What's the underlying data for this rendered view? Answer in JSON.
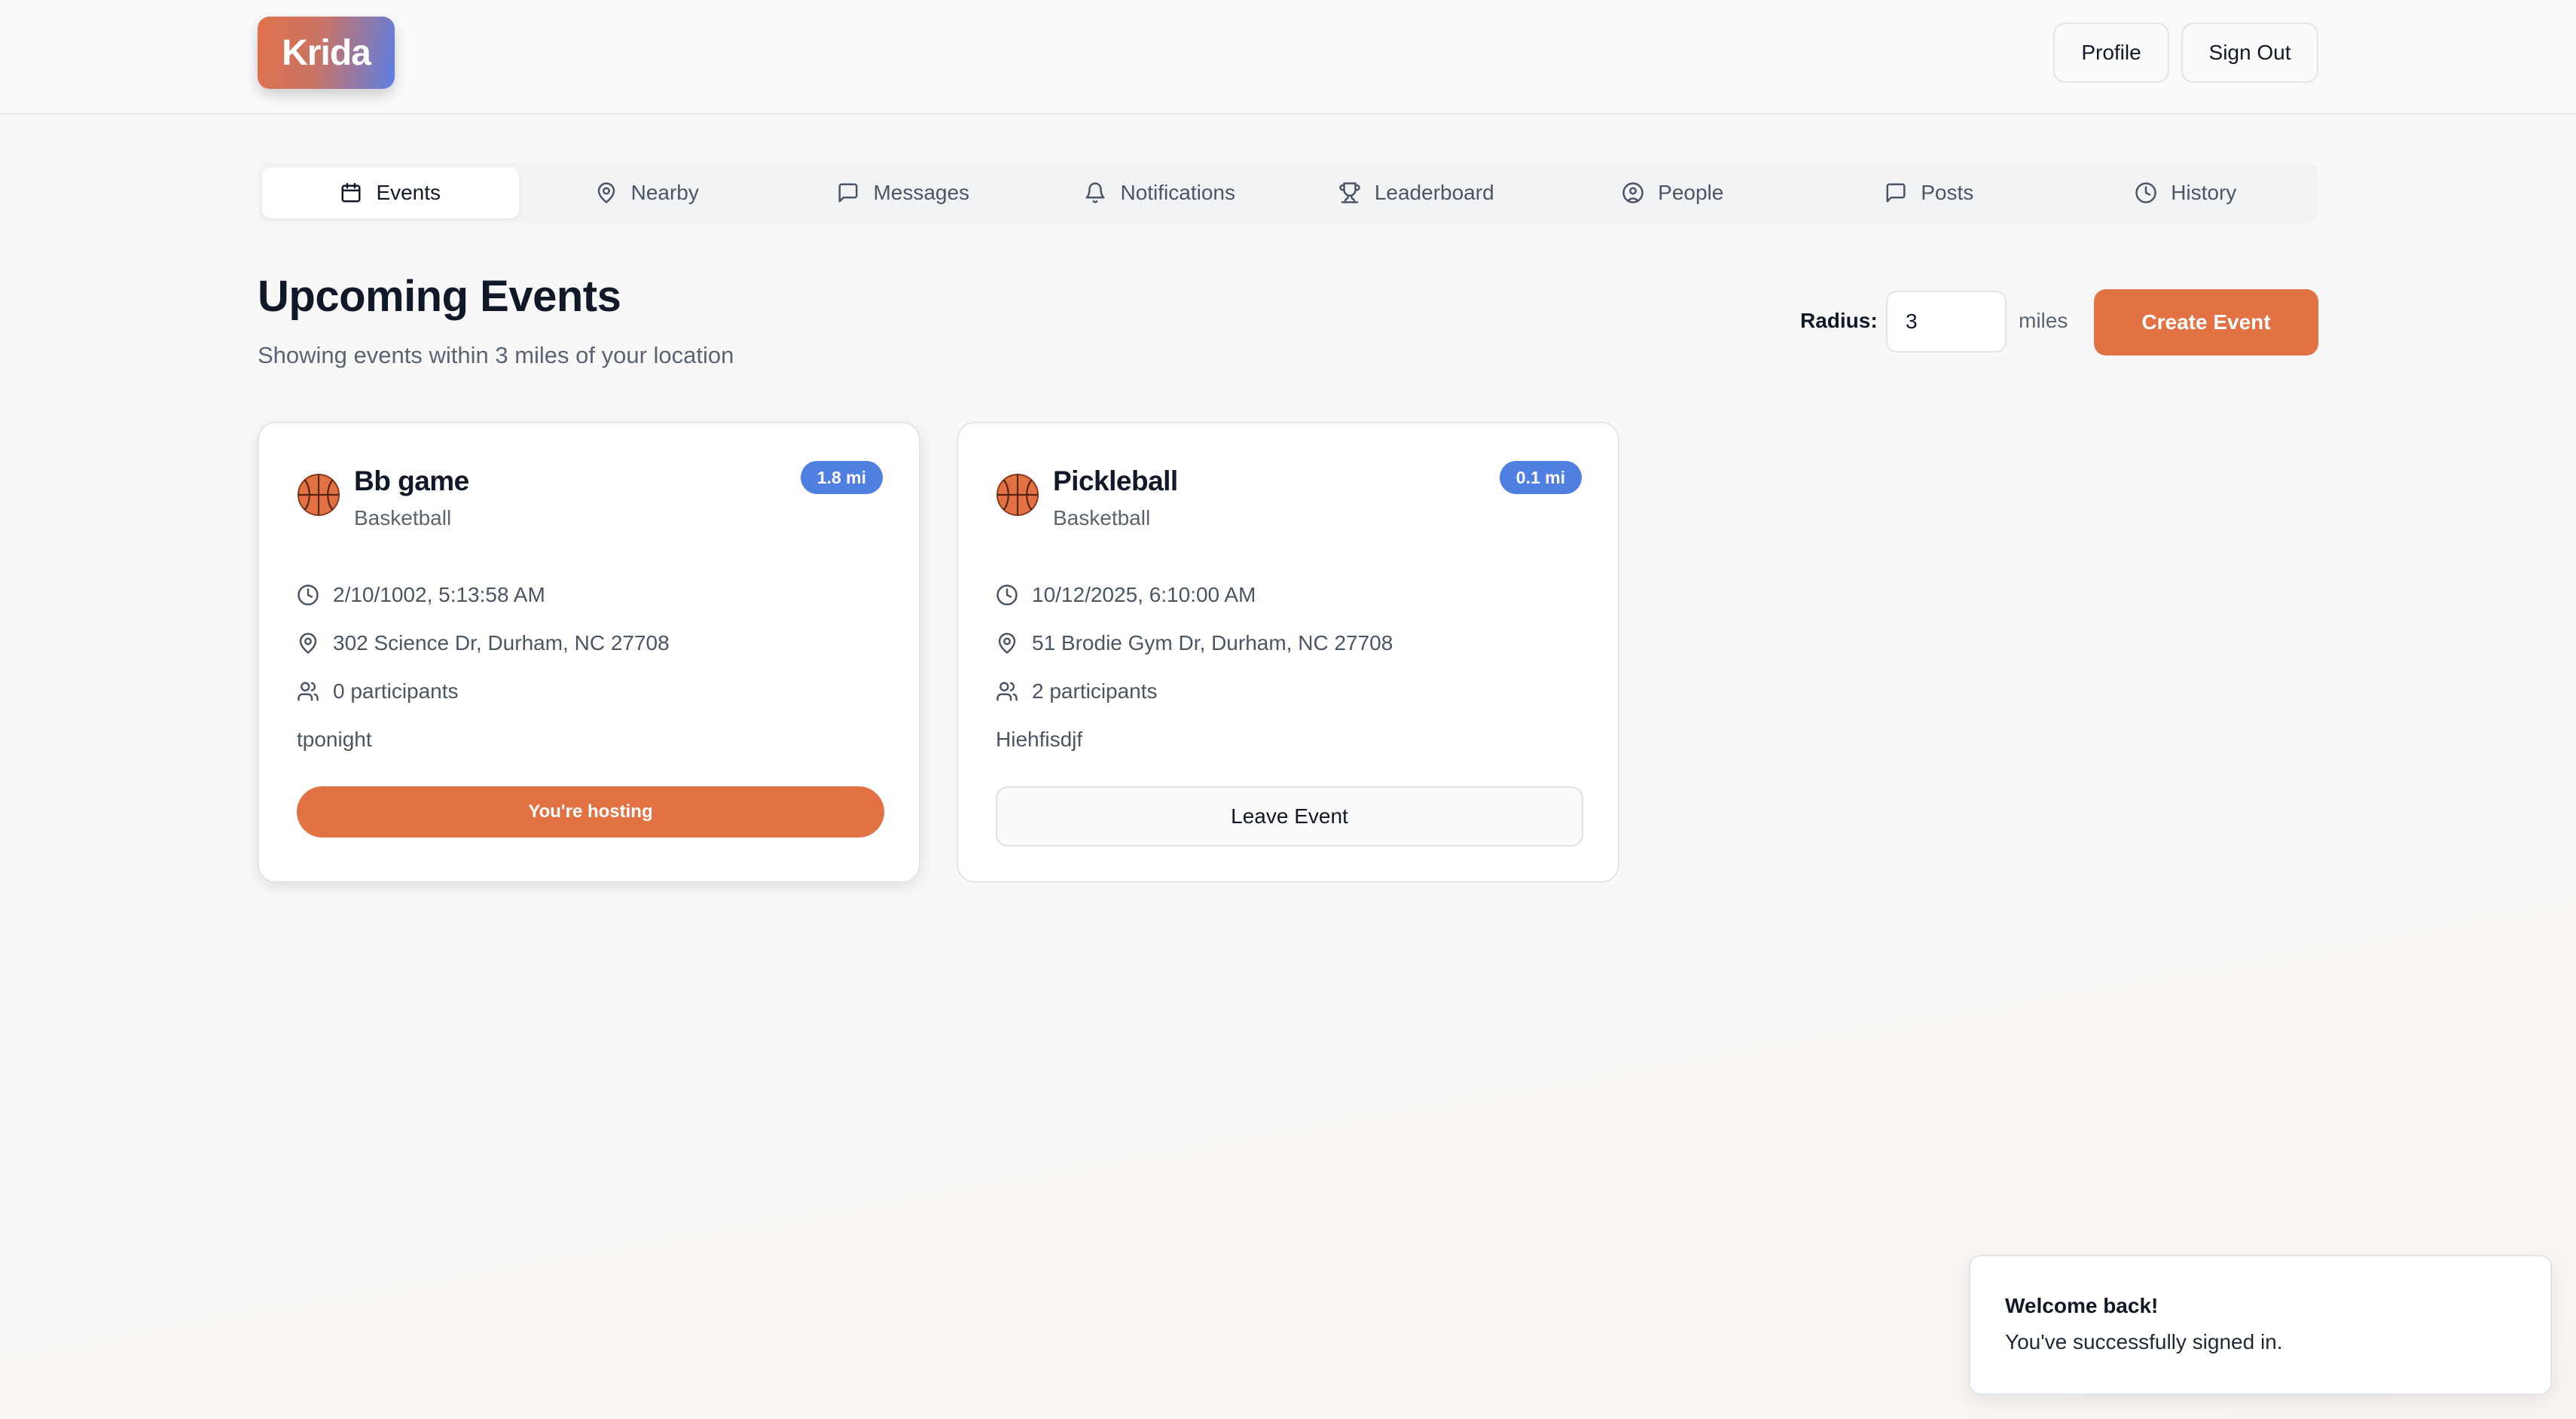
{
  "header": {
    "logo_text": "Krida",
    "profile_label": "Profile",
    "signout_label": "Sign Out"
  },
  "tabs": [
    {
      "label": "Events",
      "icon": "calendar-icon",
      "active": true
    },
    {
      "label": "Nearby",
      "icon": "map-pin-icon",
      "active": false
    },
    {
      "label": "Messages",
      "icon": "message-square-icon",
      "active": false
    },
    {
      "label": "Notifications",
      "icon": "bell-icon",
      "active": false
    },
    {
      "label": "Leaderboard",
      "icon": "trophy-icon",
      "active": false
    },
    {
      "label": "People",
      "icon": "user-circle-icon",
      "active": false
    },
    {
      "label": "Posts",
      "icon": "message-square-icon",
      "active": false
    },
    {
      "label": "History",
      "icon": "clock-icon",
      "active": false
    }
  ],
  "main": {
    "title": "Upcoming Events",
    "subtitle": "Showing events within 3 miles of your location",
    "radius_label": "Radius:",
    "radius_value": "3",
    "radius_unit": "miles",
    "create_label": "Create Event"
  },
  "events": [
    {
      "title": "Bb game",
      "sport": "Basketball",
      "distance": "1.8 mi",
      "datetime": "2/10/1002, 5:13:58 AM",
      "location": "302 Science Dr, Durham, NC 27708",
      "participants": "0 participants",
      "description": "tponight",
      "action_label": "You're hosting"
    },
    {
      "title": "Pickleball",
      "sport": "Basketball",
      "distance": "0.1 mi",
      "datetime": "10/12/2025, 6:10:00 AM",
      "location": "51 Brodie Gym Dr, Durham, NC 27708",
      "participants": "2 participants",
      "description": "Hiehfisdjf",
      "action_label": "Leave Event"
    }
  ],
  "toast": {
    "title": "Welcome back!",
    "message": "You've successfully signed in."
  },
  "colors": {
    "accent": "#e27244",
    "badge": "#4f7fe0"
  }
}
